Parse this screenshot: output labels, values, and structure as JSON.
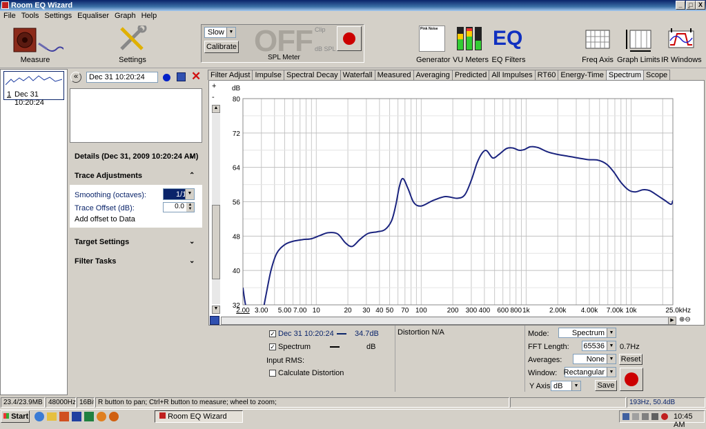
{
  "window": {
    "title": "Room EQ Wizard",
    "min": "_",
    "max": "̱□",
    "close": "X"
  },
  "menu": [
    "File",
    "Tools",
    "Settings",
    "Equaliser",
    "Graph",
    "Help"
  ],
  "toolbar": {
    "measure": "Measure",
    "settings": "Settings",
    "generator": "Generator",
    "vu": "VU Meters",
    "eq": "EQ Filters",
    "eq_logo": "EQ",
    "freq_axis": "Freq Axis",
    "graph_limits": "Graph Limits",
    "ir_windows": "IR Windows",
    "pink_noise": "Pink Noise"
  },
  "spl": {
    "speed": "Slow",
    "calibrate": "Calibrate",
    "reading": "OFF",
    "clip": "Clip",
    "unit": "dB SPL",
    "label": "SPL Meter"
  },
  "measurements": [
    {
      "index": "1",
      "name": "Dec 31 10:20:24"
    }
  ],
  "mid": {
    "name_value": "Dec 31 10:20:24",
    "details": "Details  (Dec 31, 2009 10:20:24 AM)",
    "trace_adjustments": "Trace Adjustments",
    "smoothing_label": "Smoothing (octaves):",
    "smoothing_value": "1/1",
    "offset_label": "Trace Offset (dB):",
    "offset_value": "0.0",
    "add_offset": "Add offset to Data",
    "target": "Target Settings",
    "filter_tasks": "Filter Tasks",
    "nav_back": "«"
  },
  "tabs": [
    {
      "label": "Filter Adjust"
    },
    {
      "label": "Impulse"
    },
    {
      "label": "Spectral Decay"
    },
    {
      "label": "Waterfall"
    },
    {
      "label": "Measured"
    },
    {
      "label": "Averaging"
    },
    {
      "label": "Predicted"
    },
    {
      "label": "All Impulses"
    },
    {
      "label": "RT60"
    },
    {
      "label": "Energy-Time"
    },
    {
      "label": "Spectrum",
      "active": true
    },
    {
      "label": "Scope"
    }
  ],
  "chart_data": {
    "type": "line",
    "xscale": "log",
    "xlim": [
      2,
      25000
    ],
    "ylim": [
      32,
      80
    ],
    "ylabel": "dB",
    "y_ticks": [
      "80",
      "72",
      "64",
      "56",
      "48",
      "40",
      "32"
    ],
    "x_ticks": [
      {
        "v": 2,
        "t": "2.00"
      },
      {
        "v": 3,
        "t": "3.00"
      },
      {
        "v": 5,
        "t": "5.00"
      },
      {
        "v": 7,
        "t": "7.00"
      },
      {
        "v": 10,
        "t": "10"
      },
      {
        "v": 20,
        "t": "20"
      },
      {
        "v": 30,
        "t": "30"
      },
      {
        "v": 40,
        "t": "40"
      },
      {
        "v": 50,
        "t": "50"
      },
      {
        "v": 70,
        "t": "70"
      },
      {
        "v": 100,
        "t": "100"
      },
      {
        "v": 200,
        "t": "200"
      },
      {
        "v": 300,
        "t": "300"
      },
      {
        "v": 400,
        "t": "400"
      },
      {
        "v": 600,
        "t": "600"
      },
      {
        "v": 800,
        "t": "800"
      },
      {
        "v": 1000,
        "t": "1k"
      },
      {
        "v": 2000,
        "t": "2.00k"
      },
      {
        "v": 4000,
        "t": "4.00k"
      },
      {
        "v": 7000,
        "t": "7.00k"
      },
      {
        "v": 10000,
        "t": "10k"
      },
      {
        "v": 25000,
        "t": "25.0kHz"
      }
    ],
    "series": [
      {
        "color": "#1a237e",
        "x": [
          2,
          2.1,
          2.3,
          2.6,
          3,
          3.3,
          3.7,
          4.2,
          5,
          6,
          7.5,
          9,
          11,
          13,
          16,
          19,
          22,
          26,
          31,
          38,
          45,
          52,
          57,
          62,
          67,
          75,
          85,
          100,
          130,
          170,
          220,
          260,
          300,
          340,
          380,
          420,
          480,
          550,
          650,
          750,
          850,
          950,
          1100,
          1300,
          1600,
          2000,
          2500,
          3100,
          3900,
          4800,
          5800,
          6800,
          8000,
          9500,
          11000,
          13000,
          15000,
          18000,
          21000,
          24000,
          25000
        ],
        "y": [
          36,
          32.5,
          28,
          25,
          29,
          34,
          40,
          44,
          46,
          46.8,
          47.2,
          47.4,
          48.2,
          48.8,
          48.5,
          46.4,
          45.6,
          47.2,
          48.6,
          49,
          49.5,
          51.5,
          55,
          59.6,
          61.4,
          59,
          55.8,
          55,
          56.3,
          57.2,
          56.8,
          57.6,
          61,
          65,
          67.3,
          67.9,
          66.2,
          67,
          68.4,
          68.5,
          68,
          68.1,
          68.8,
          68.6,
          67.6,
          67,
          66.6,
          66.2,
          65.8,
          65.7,
          64.8,
          63,
          60.5,
          58.7,
          58.3,
          58.8,
          58.6,
          57.4,
          56.3,
          55.4,
          56.3
        ]
      }
    ]
  },
  "graph_controls": {
    "zoom_in": "+",
    "zoom_out": "-"
  },
  "legend": {
    "trace1_name": "Dec 31 10:20:24",
    "trace1_value": "34.7dB",
    "trace2_name": "Spectrum",
    "trace2_value": "dB",
    "input_rms": "Input RMS:",
    "calc_distortion": "Calculate Distortion",
    "distortion": "Distortion N/A"
  },
  "analyser": {
    "mode_label": "Mode:",
    "mode_value": "Spectrum",
    "fft_label": "FFT Length:",
    "fft_value": "65536",
    "fft_res": "0.7Hz",
    "avg_label": "Averages:",
    "avg_value": "None",
    "reset": "Reset",
    "window_label": "Window:",
    "window_value": "Rectangular",
    "yaxis_label": "Y Axis:",
    "yaxis_value": "dB",
    "save": "Save"
  },
  "status": {
    "memory": "23.4/23.9MB",
    "rate": "48000Hz",
    "bits": "16Bit",
    "hint": "R button to pan; Ctrl+R button to measure; wheel to zoom;",
    "cursor": "193Hz, 50.4dB"
  },
  "taskbar": {
    "start": "Start",
    "task": "Room EQ Wizard",
    "clock": "10:45 AM"
  }
}
